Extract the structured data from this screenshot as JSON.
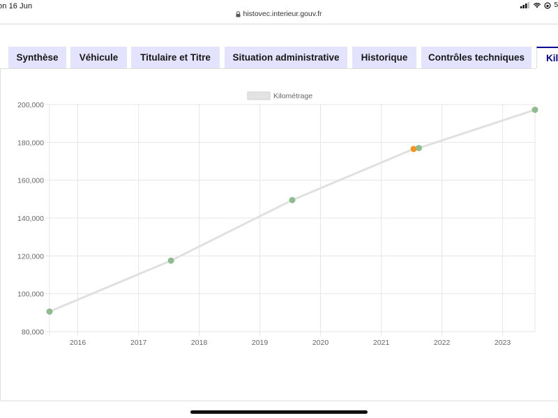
{
  "status_bar": {
    "time": "on 16 Jun",
    "battery_text": "5"
  },
  "browser": {
    "url": "histovec.interieur.gouv.fr"
  },
  "tabs": [
    {
      "label": "Synthèse"
    },
    {
      "label": "Véhicule"
    },
    {
      "label": "Titulaire et Titre"
    },
    {
      "label": "Situation administrative"
    },
    {
      "label": "Historique"
    },
    {
      "label": "Contrôles techniques"
    },
    {
      "label": "Kilo",
      "active": true
    }
  ],
  "colors": {
    "tab_bg": "#e3e3fd",
    "accent": "#000091",
    "line": "#dddddd",
    "point_green": "#8fbc8f",
    "point_orange": "#f7941d"
  },
  "chart_data": {
    "type": "line",
    "legend": "Kilométrage",
    "legend_placement": "top-center",
    "grid": true,
    "ylim": [
      80000,
      200000
    ],
    "yticks": [
      "80,000",
      "100,000",
      "120,000",
      "140,000",
      "160,000",
      "180,000",
      "200,000"
    ],
    "xlim": [
      "2015-07-15",
      "2023-07-15"
    ],
    "xticks": [
      "2016",
      "2017",
      "2018",
      "2019",
      "2020",
      "2021",
      "2022",
      "2023"
    ],
    "series": [
      {
        "name": "Kilométrage",
        "points": [
          {
            "x": "2015-07-15",
            "y": 90600,
            "status": "ok"
          },
          {
            "x": "2017-07-15",
            "y": 117500,
            "status": "ok"
          },
          {
            "x": "2019-07-15",
            "y": 149500,
            "status": "ok"
          },
          {
            "x": "2021-07-15",
            "y": 176500,
            "status": "warning"
          },
          {
            "x": "2021-08-15",
            "y": 177000,
            "status": "ok"
          },
          {
            "x": "2023-07-15",
            "y": 197200,
            "status": "ok"
          }
        ]
      }
    ]
  }
}
